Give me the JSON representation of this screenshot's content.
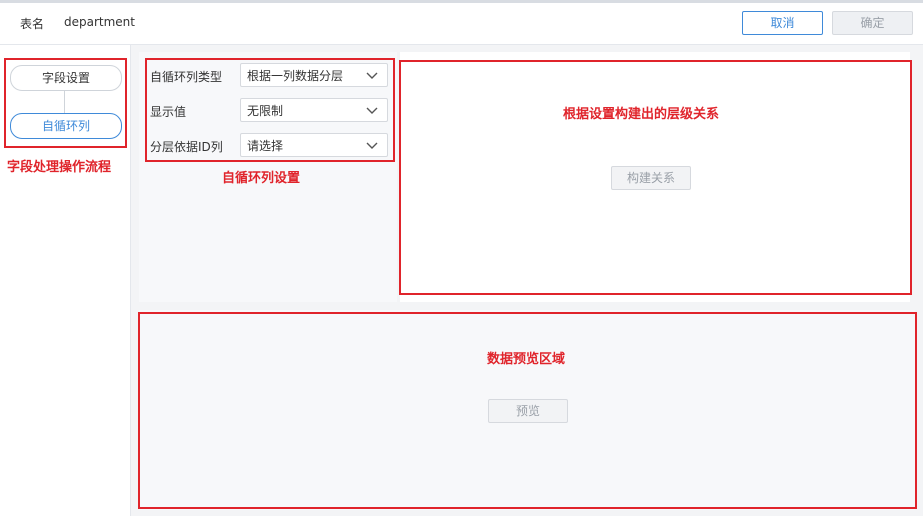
{
  "header": {
    "table_label": "表名",
    "table_name": "department",
    "cancel_label": "取消",
    "confirm_label": "确定"
  },
  "steps": {
    "items": [
      {
        "label": "字段设置"
      },
      {
        "label": "自循环列"
      }
    ],
    "annotation": "字段处理操作流程"
  },
  "settings": {
    "fields": [
      {
        "label": "自循环列类型",
        "value": "根据一列数据分层"
      },
      {
        "label": "显示值",
        "value": "无限制"
      },
      {
        "label": "分层依据ID列",
        "value": "请选择"
      }
    ],
    "annotation": "自循环列设置"
  },
  "hierarchy": {
    "annotation": "根据设置构建出的层级关系",
    "build_label": "构建关系"
  },
  "preview": {
    "annotation": "数据预览区域",
    "preview_label": "预览"
  },
  "colors": {
    "accent": "#3f8ad9",
    "annotation_red": "#e0242b"
  },
  "icons": {
    "select_arrow": "chevron-down-icon"
  }
}
